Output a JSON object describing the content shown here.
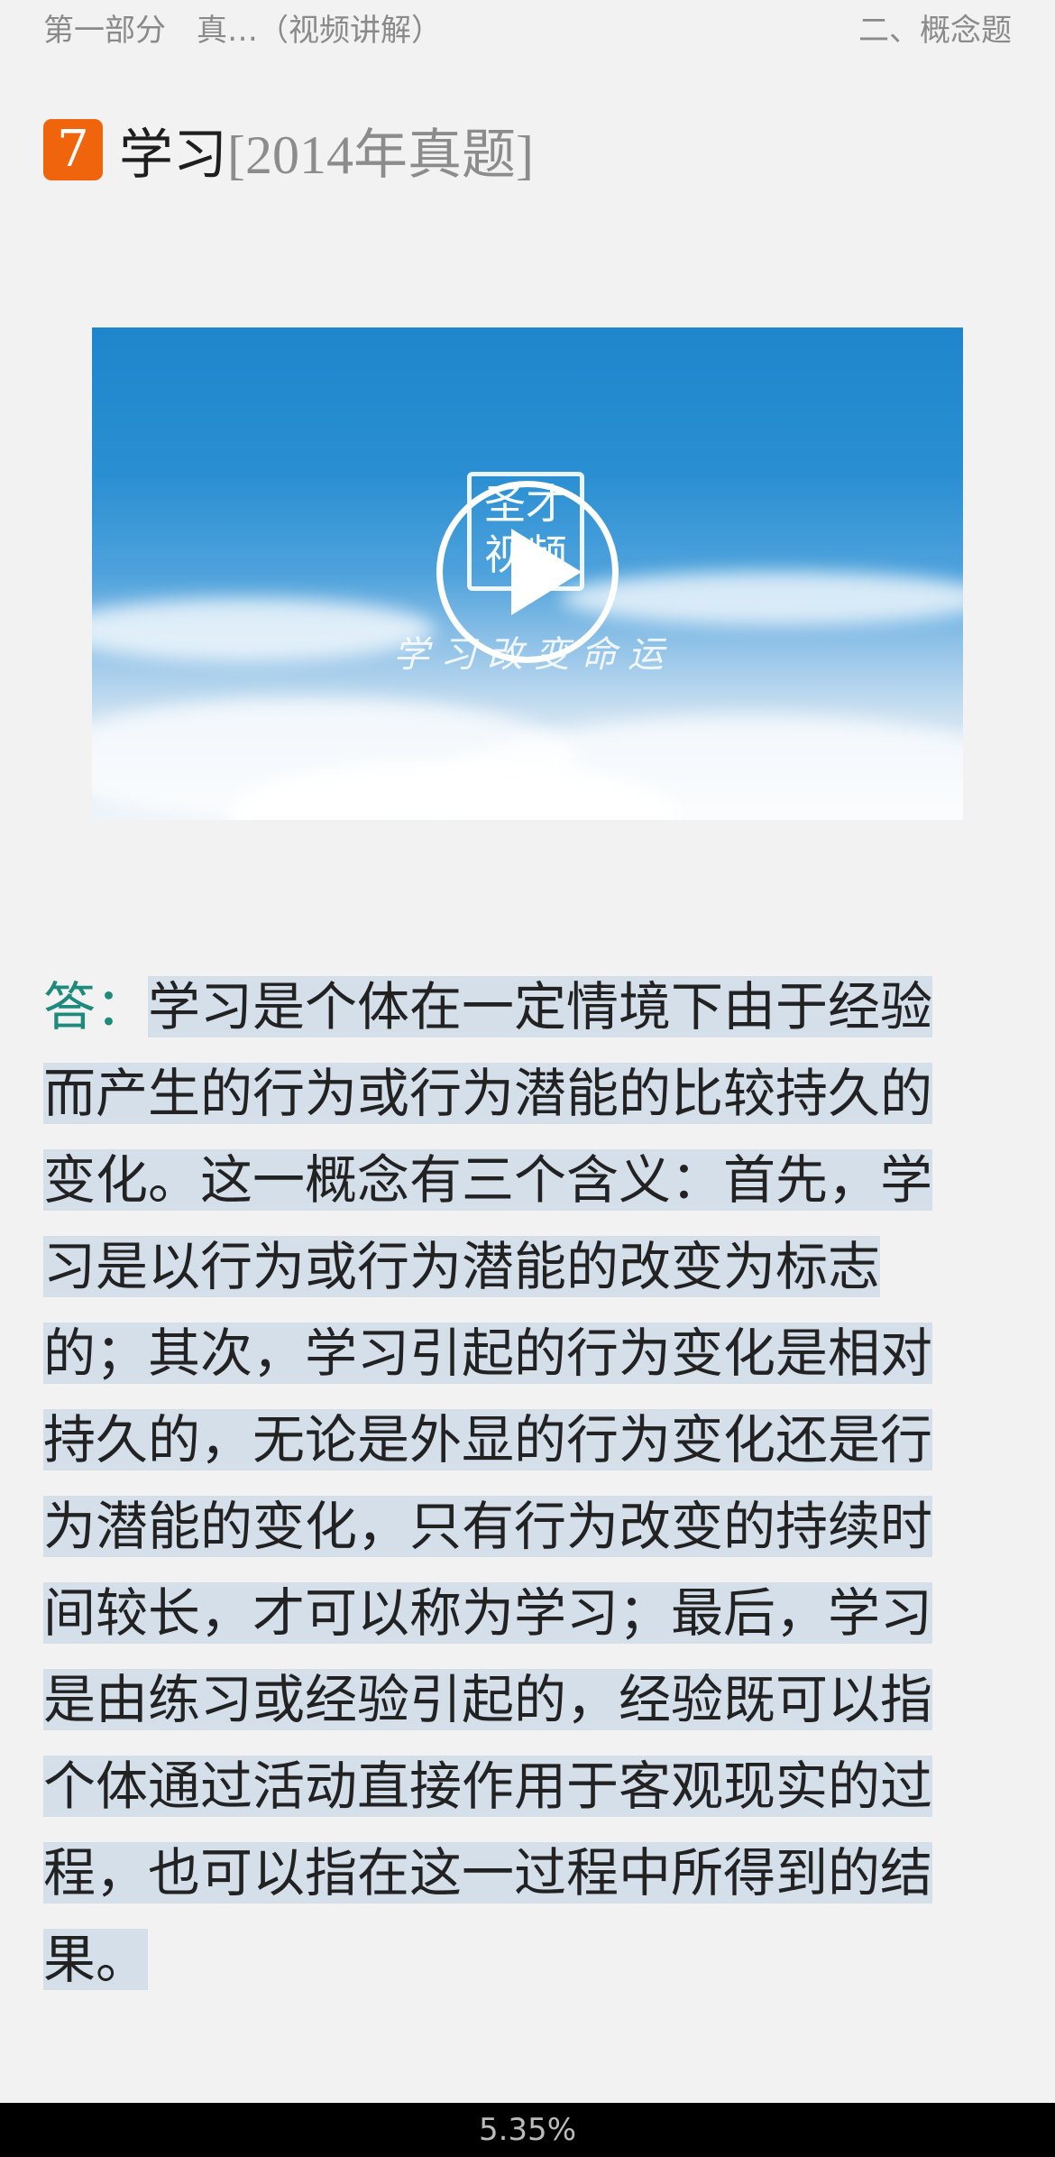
{
  "header": {
    "breadcrumb_left": "第一部分　真…（视频讲解）",
    "breadcrumb_right": "二、概念题"
  },
  "heading": {
    "number": "7",
    "title": "学习",
    "year_tag": "[2014年真题]"
  },
  "video": {
    "logo_line1": "圣才",
    "logo_line2": "视频",
    "slogan": "学习改变命运",
    "play_icon": "play-icon",
    "sky_color": "#1f86cc"
  },
  "answer": {
    "label": "答：",
    "text": "学习是个体在一定情境下由于经验而产生的行为或行为潜能的比较持久的变化。这一概念有三个含义：首先，学习是以行为或行为潜能的改变为标志的；其次，学习引起的行为变化是相对持久的，无论是外显的行为变化还是行为潜能的变化，只有行为改变的持续时间较长，才可以称为学习；最后，学习是由练习或经验引起的，经验既可以指个体通过活动直接作用于客观现实的过程，也可以指在这一过程中所得到的结果。",
    "label_color": "#1d8a7c",
    "highlight_color": "#d4dfea"
  },
  "footer": {
    "progress": "5.35%",
    "progress_value": 5.35
  },
  "colors": {
    "badge": "#f0650c",
    "background": "#f2f2f2"
  }
}
